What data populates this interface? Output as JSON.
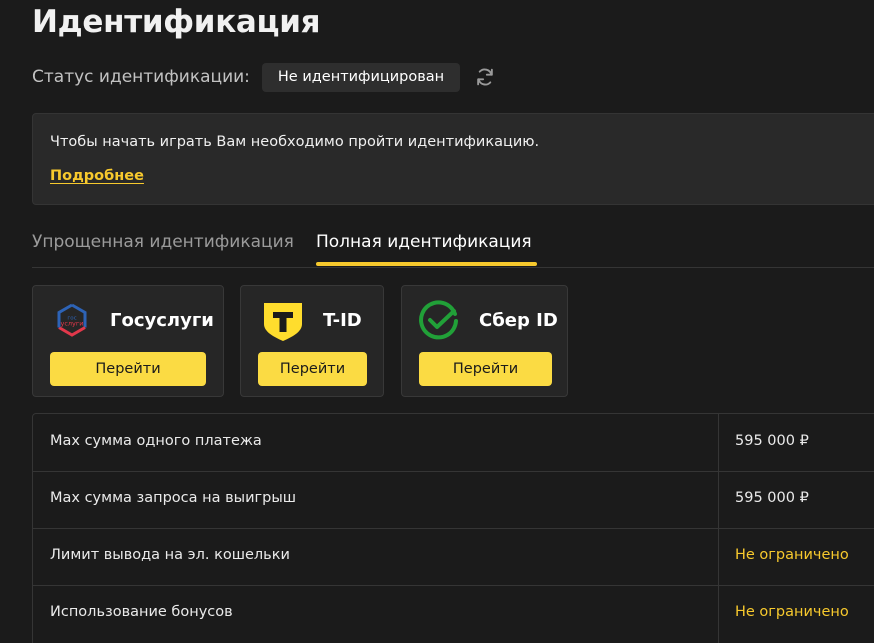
{
  "page": {
    "title": "Идентификация"
  },
  "status": {
    "label": "Статус идентификации:",
    "value": "Не идентифицирован",
    "refresh_icon": "refresh-icon"
  },
  "notice": {
    "text": "Чтобы начать играть Вам необходимо пройти идентификацию.",
    "link": "Подробнее"
  },
  "tabs": [
    {
      "label": "Упрощенная идентификация",
      "active": false
    },
    {
      "label": "Полная идентификация",
      "active": true
    }
  ],
  "providers": [
    {
      "name": "Госуслуги",
      "logo_text": "гос услуги",
      "button": "Перейти",
      "icon": "gosuslugi-logo-icon"
    },
    {
      "name": "T-ID",
      "logo_text": "T",
      "button": "Перейти",
      "icon": "tid-shield-icon"
    },
    {
      "name": "Сбер ID",
      "button": "Перейти",
      "icon": "sber-check-icon"
    }
  ],
  "limits": [
    {
      "name": "Max сумма одного платежа",
      "value": "595 000 ₽",
      "highlight": false
    },
    {
      "name": "Max сумма запроса на выигрыш",
      "value": "595 000 ₽",
      "highlight": false
    },
    {
      "name": "Лимит вывода на эл. кошельки",
      "value": "Не ограничено",
      "highlight": true
    },
    {
      "name": "Использование бонусов",
      "value": "Не ограничено",
      "highlight": true
    }
  ],
  "colors": {
    "background": "#1b1b1b",
    "accent": "#f7c92d",
    "button": "#fbdb43",
    "panel": "#292929",
    "sber_green": "#21a038",
    "gos_blue": "#2d63b6",
    "gos_red": "#e2384b"
  }
}
